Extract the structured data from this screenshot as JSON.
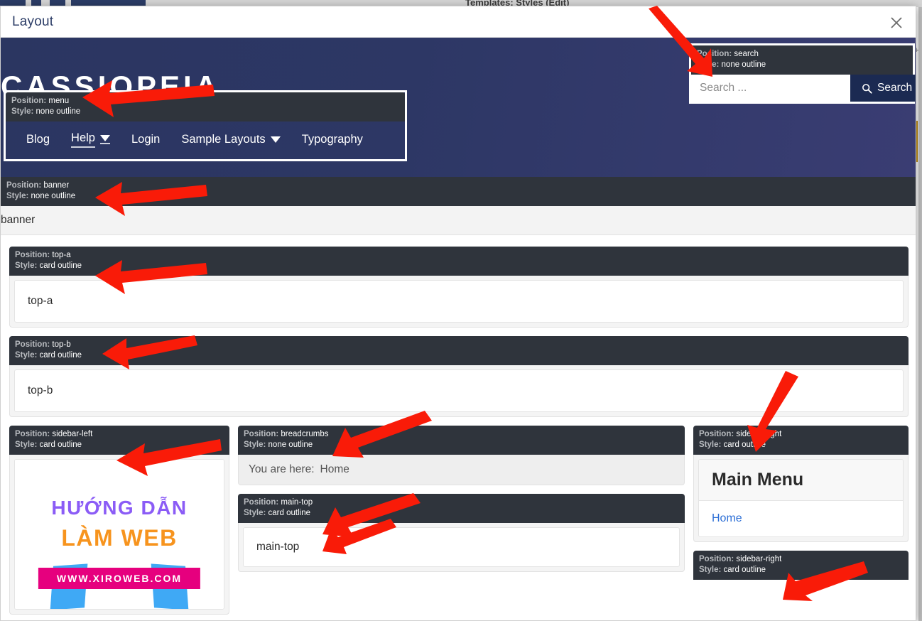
{
  "background": {
    "page_title": "Templates: Styles (Edit)"
  },
  "modal": {
    "title": "Layout",
    "close_icon": "close-icon"
  },
  "site": {
    "brand": "CASSIOPEIA",
    "accent_dark": "#2b3661",
    "accent_button": "#1b2a52",
    "badge_bg": "#2f343c",
    "link_color": "#2d6fd6"
  },
  "menu_module": {
    "position_key": "Position:",
    "position_value": "menu",
    "style_key": "Style:",
    "style_value": "none outline",
    "items": [
      {
        "label": "Blog",
        "has_caret": false,
        "active": false
      },
      {
        "label": "Help",
        "has_caret": true,
        "active": true
      },
      {
        "label": "Login",
        "has_caret": false,
        "active": false
      },
      {
        "label": "Sample Layouts",
        "has_caret": true,
        "active": false
      },
      {
        "label": "Typography",
        "has_caret": false,
        "active": false
      }
    ]
  },
  "search_module": {
    "position_key": "Position:",
    "position_value": "search",
    "style_key": "Style:",
    "style_value": "none outline",
    "input_placeholder": "Search ...",
    "input_value": "",
    "button_label": "Search",
    "button_icon": "search-icon"
  },
  "banner_module": {
    "position_key": "Position:",
    "position_value": "banner",
    "style_key": "Style:",
    "style_value": "none outline",
    "body_text": "banner"
  },
  "top_a_module": {
    "position_key": "Position:",
    "position_value": "top-a",
    "style_key": "Style:",
    "style_value": "card outline",
    "body_text": "top-a"
  },
  "top_b_module": {
    "position_key": "Position:",
    "position_value": "top-b",
    "style_key": "Style:",
    "style_value": "card outline",
    "body_text": "top-b"
  },
  "sidebar_left_module": {
    "position_key": "Position:",
    "position_value": "sidebar-left",
    "style_key": "Style:",
    "style_value": "card outline",
    "promo": {
      "line1": "HƯỚNG DẪN",
      "line2": "LÀM WEB",
      "ribbon": "WWW.XIROWEB.COM"
    }
  },
  "breadcrumbs_module": {
    "position_key": "Position:",
    "position_value": "breadcrumbs",
    "style_key": "Style:",
    "style_value": "none outline",
    "prefix": "You are here:",
    "current": "Home"
  },
  "main_top_module": {
    "position_key": "Position:",
    "position_value": "main-top",
    "style_key": "Style:",
    "style_value": "card outline",
    "body_text": "main-top"
  },
  "sidebar_right_module_1": {
    "position_key": "Position:",
    "position_value": "sidebar-right",
    "style_key": "Style:",
    "style_value": "card outline",
    "widget_title": "Main Menu",
    "widget_items": [
      {
        "label": "Home"
      }
    ]
  },
  "sidebar_right_module_2": {
    "position_key": "Position:",
    "position_value": "sidebar-right",
    "style_key": "Style:",
    "style_value": "card outline"
  },
  "annotations": {
    "arrow_color": "#f91b08",
    "count": 11
  }
}
